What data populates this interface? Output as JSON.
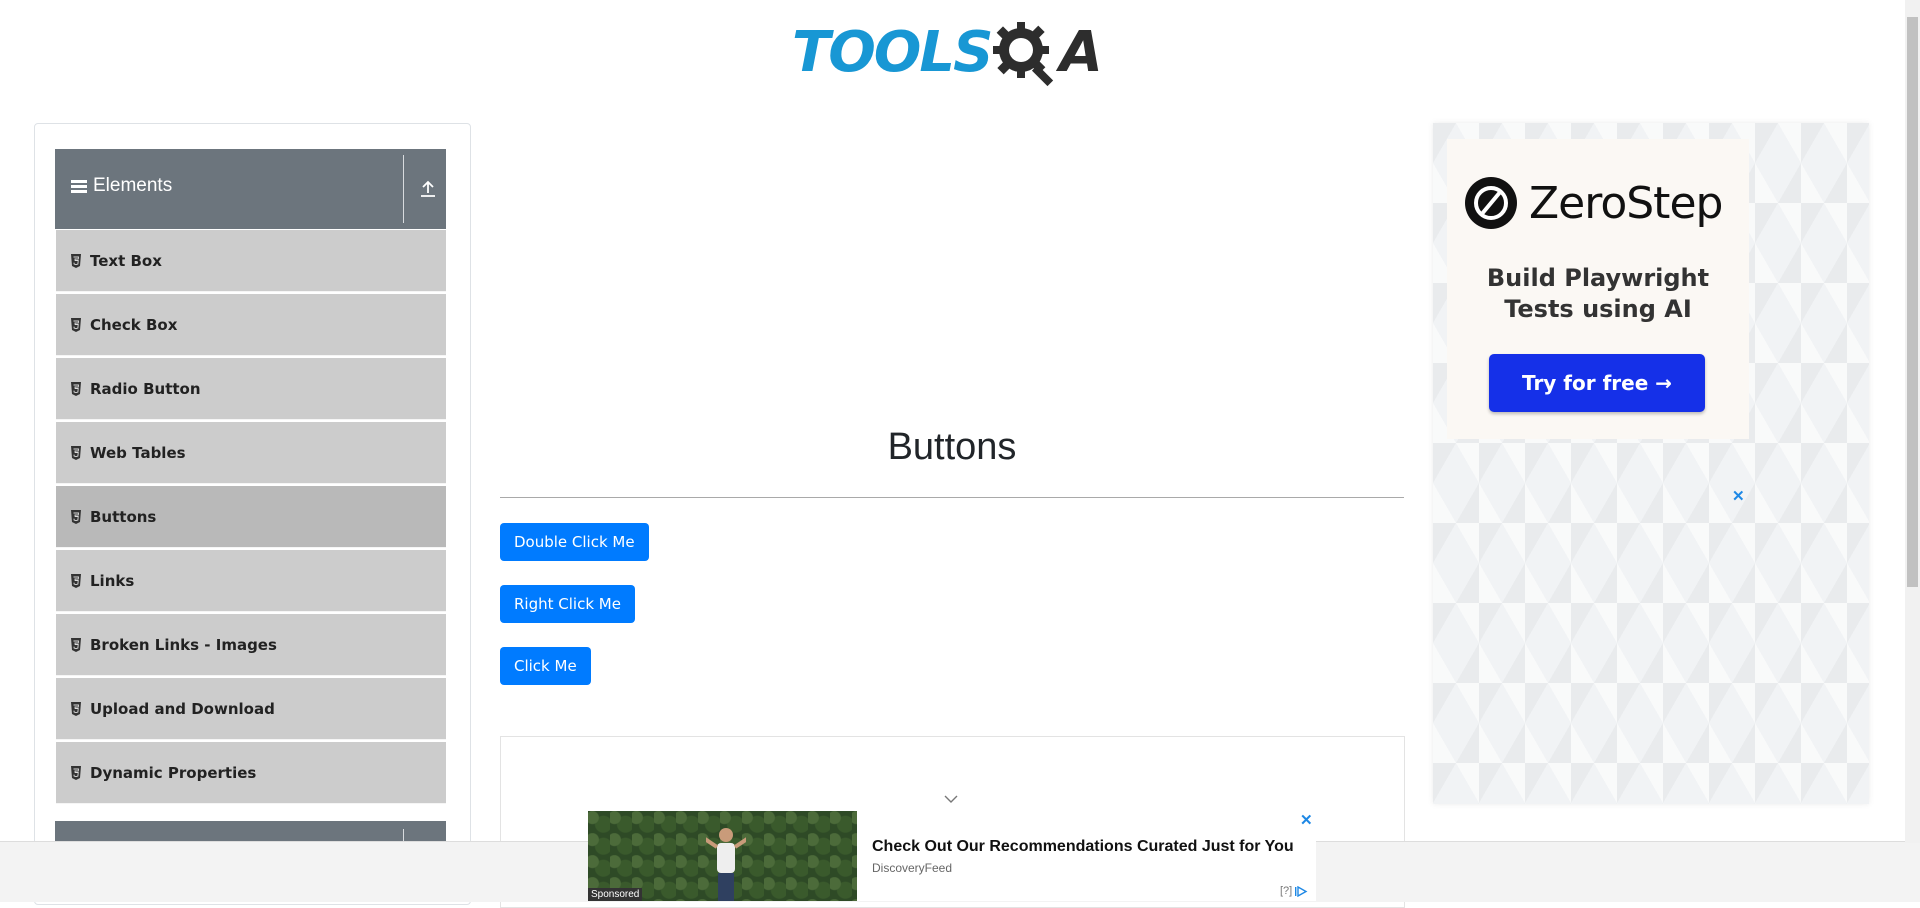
{
  "logo": {
    "tools": "TOOLS",
    "qa": "A"
  },
  "sidebar": {
    "group_title": "Elements",
    "items": [
      {
        "label": "Text Box"
      },
      {
        "label": "Check Box"
      },
      {
        "label": "Radio Button"
      },
      {
        "label": "Web Tables"
      },
      {
        "label": "Buttons",
        "active": true
      },
      {
        "label": "Links"
      },
      {
        "label": "Broken Links - Images"
      },
      {
        "label": "Upload and Download"
      },
      {
        "label": "Dynamic Properties"
      }
    ]
  },
  "main": {
    "title": "Buttons",
    "buttons": {
      "double_click": "Double Click Me",
      "right_click": "Right Click Me",
      "click": "Click Me"
    }
  },
  "right_ad": {
    "brand": "ZeroStep",
    "tagline_1": "Build Playwright",
    "tagline_2": "Tests using AI",
    "cta": "Try for free →",
    "close": "✕"
  },
  "bottom_ad": {
    "headline": "Check Out Our Recommendations Curated Just for You",
    "source": "DiscoveryFeed",
    "sponsored": "Sponsored",
    "close": "✕",
    "info": "[?]"
  },
  "colors": {
    "primary": "#007bff",
    "sidebar_header": "#6c757d",
    "menu_item": "#cccccc",
    "logo_blue": "#1897d4",
    "ad_cta": "#1530e8"
  }
}
